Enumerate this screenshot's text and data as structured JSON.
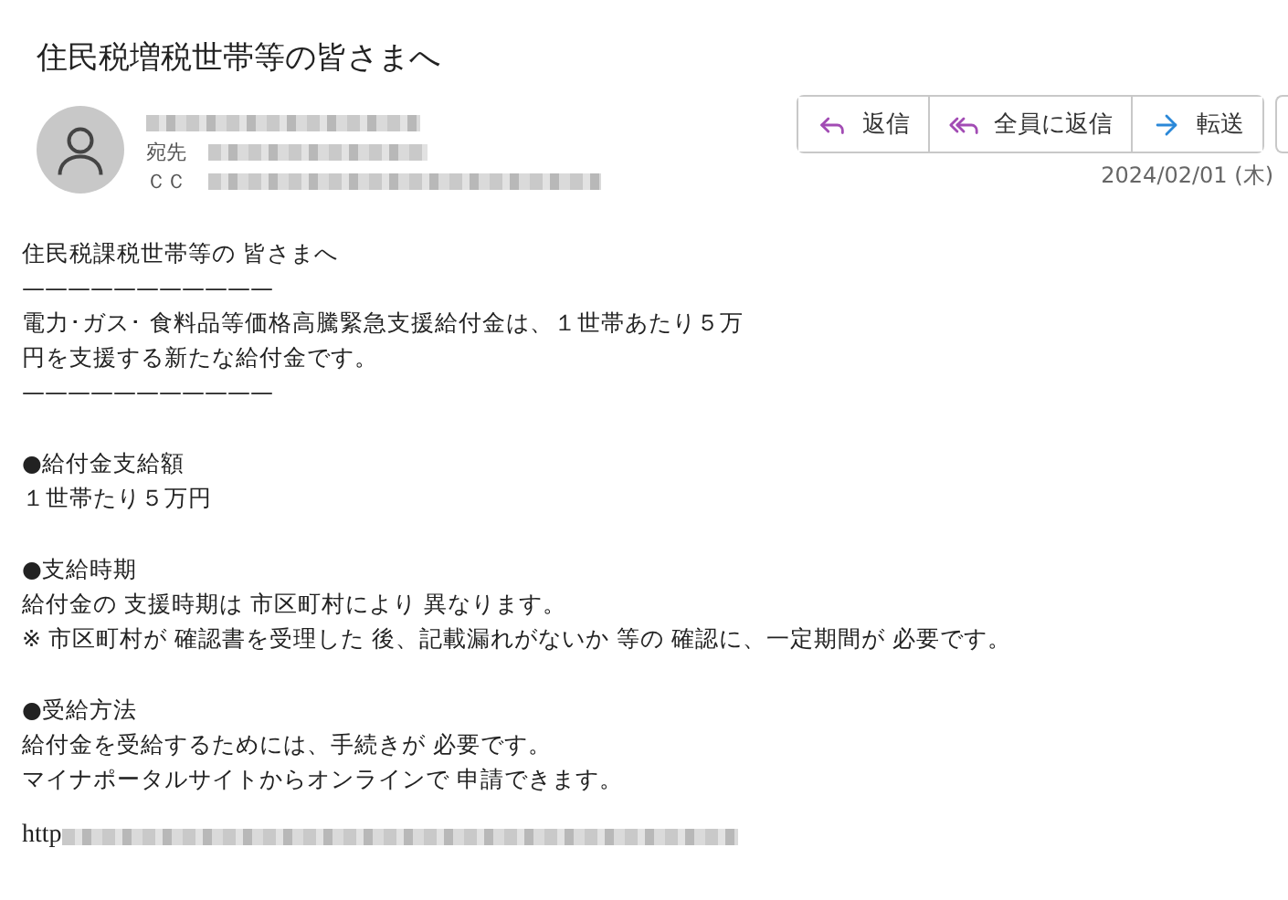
{
  "subject": "住民税増税世帯等の皆さまへ",
  "header": {
    "to_label": "宛先",
    "cc_label": "ＣＣ",
    "date": "2024/02/01 (木)"
  },
  "actions": [
    {
      "kind": "reply",
      "label": "返信"
    },
    {
      "kind": "reply_all",
      "label": "全員に返信"
    },
    {
      "kind": "forward",
      "label": "転送"
    }
  ],
  "body": [
    {
      "lines": [
        "住民税課税世帯等の 皆さまへ",
        "———————————",
        "電力･ガス･ 食料品等価格高騰緊急支援給付金は、１世帯あたり５万",
        "円を支援する新たな給付金です。",
        "———————————"
      ]
    },
    {
      "lines": [
        "●給付金支給額",
        "１世帯たり５万円"
      ]
    },
    {
      "lines": [
        "●支給時期",
        "給付金の 支援時期は 市区町村により 異なります。",
        "※ 市区町村が 確認書を受理した 後、記載漏れがないか 等の 確認に、一定期間が 必要です。"
      ]
    },
    {
      "lines": [
        "●受給方法",
        "給付金を受給するためには、手続きが 必要です。",
        "マイナポータルサイトからオンラインで 申請できます。"
      ]
    }
  ],
  "link_prefix": "http"
}
